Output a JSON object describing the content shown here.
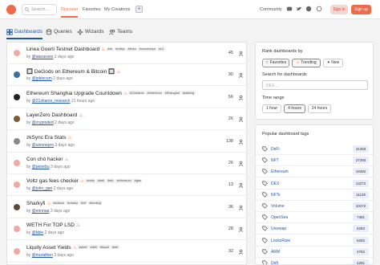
{
  "header": {
    "search_placeholder": "Search...",
    "nav": [
      "Discover",
      "Favorites",
      "My Creations"
    ],
    "plus": "+",
    "community": "Community",
    "sign_in": "Sign in",
    "sign_up": "Sign up"
  },
  "tabs": [
    "Dashboards",
    "Queries",
    "Wizards",
    "Teams"
  ],
  "dashboards": [
    {
      "title": "Linea Goerli Testnet Dashboard",
      "tags": [
        "#zk",
        "#rollup",
        "#linea",
        "#consensys",
        "#L2"
      ],
      "owner": "@ataraxxes",
      "age": "2 days ago",
      "stars": "45",
      "avatar": "#f4a6a0"
    },
    {
      "title": "🔲 DeGods on Ethereum & Bitcoin 🔲",
      "tags": [],
      "owner": "@jpbincum",
      "age": "2 days ago",
      "stars": "90",
      "avatar": "#3a6ea5"
    },
    {
      "title": "Ethereum Shanghai Upgrade Countdown",
      "tags": [
        "#21shares",
        "#ethereum",
        "#Shanghai",
        "#staking"
      ],
      "owner": "@21shares_research",
      "age": "21 hours ago",
      "stars": "56",
      "avatar": "#222222"
    },
    {
      "title": "LayerZero Dashboard",
      "tags": [],
      "owner": "@cryptoded",
      "age": "2 days ago",
      "stars": "26",
      "avatar": "#7a5c3a"
    },
    {
      "title": "zkSync Era Stats",
      "tags": [],
      "owner": "@unionepro",
      "age": "3 days ago",
      "stars": "138",
      "avatar": "#888888"
    },
    {
      "title": "Con chó hacker",
      "tags": [],
      "owner": "@peterbu",
      "age": "3 days ago",
      "stars": "26",
      "avatar": "#f4a6a0"
    },
    {
      "title": "Voltz gas fees checker",
      "tags": [
        "#voltz",
        "#defi",
        "#eth",
        "#ethereum",
        "#gas"
      ],
      "owner": "@john_gari",
      "age": "2 days ago",
      "stars": "13",
      "avatar": "#f4a6a0"
    },
    {
      "title": "Sharkyfi",
      "tags": [
        "#solana",
        "#sharky",
        "#nft",
        "#lending"
      ],
      "owner": "@ennnaa",
      "age": "3 days ago",
      "stars": "36",
      "avatar": "#5a4a3a"
    },
    {
      "title": "WETH For TOP LSD",
      "tags": [],
      "owner": "@bbie",
      "age": "2 days ago",
      "stars": "28",
      "avatar": "#f4a6a0"
    },
    {
      "title": "Liquity Asset Yields",
      "tags": [
        "#yield",
        "#defi",
        "#liquid",
        "#eth"
      ],
      "owner": "@murathen",
      "age": "3 days ago",
      "stars": "32",
      "avatar": "#f4a6a0"
    }
  ],
  "rank": {
    "title": "Rank dashboards by",
    "options": [
      "Favorites",
      "Trending",
      "New"
    ],
    "active": "Trending",
    "search_label": "Search for dashboards",
    "search_placeholder": "DEX...",
    "time_label": "Time range",
    "time_options": [
      "1 hour",
      "4 hours",
      "24 hours"
    ],
    "time_active": "4 hours"
  },
  "popular_tags": {
    "title": "Popular dashboard tags",
    "items": [
      {
        "name": "DeFi",
        "count": "41283"
      },
      {
        "name": "NFT",
        "count": "27293"
      },
      {
        "name": "Ethereum",
        "count": "19392"
      },
      {
        "name": "DEX",
        "count": "13272"
      },
      {
        "name": "NFTs",
        "count": "11129"
      },
      {
        "name": "Volume",
        "count": "10272"
      },
      {
        "name": "OpenSea",
        "count": "7381"
      },
      {
        "name": "Uniswap",
        "count": "6283"
      },
      {
        "name": "LooksRare",
        "count": "5282"
      },
      {
        "name": "ARM",
        "count": "4782"
      },
      {
        "name": "Defi",
        "count": "4281"
      }
    ]
  },
  "colors": {
    "accent": "#f06a4a",
    "link": "#2255aa"
  }
}
